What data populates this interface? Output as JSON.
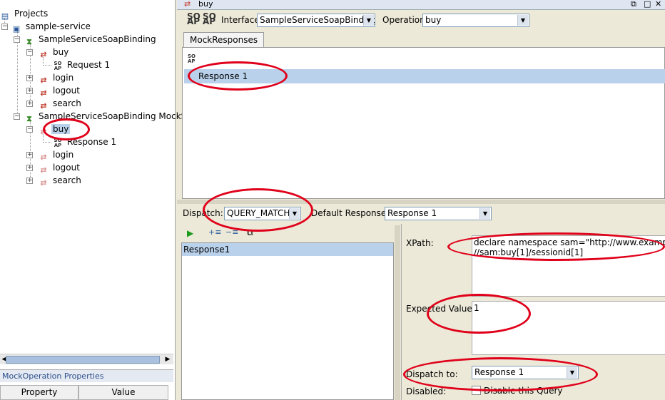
{
  "tree": {
    "projects": "Projects",
    "project": "sample-service",
    "binding": "SampleServiceSoapBinding",
    "binding_ops": [
      "buy",
      "login",
      "logout",
      "search"
    ],
    "request": "Request 1",
    "mock_service": "SampleServiceSoapBinding MockSe",
    "mock_ops": [
      "buy",
      "login",
      "logout",
      "search"
    ],
    "mock_response": "Response 1"
  },
  "props": {
    "title": "MockOperation Properties",
    "col_property": "Property",
    "col_value": "Value"
  },
  "window": {
    "title": "buy"
  },
  "toolbar": {
    "interface_label": "Interface",
    "interface_value": "SampleServiceSoapBinding",
    "operation_label": "Operation",
    "operation_value": "buy"
  },
  "mock_responses": {
    "tab_label": "MockResponses",
    "items": [
      "Response 1"
    ]
  },
  "dispatch": {
    "label": "Dispatch:",
    "value": "QUERY_MATCH",
    "default_response_label": "Default Response:",
    "default_response_value": "Response 1"
  },
  "queries": {
    "items": [
      "Response1"
    ]
  },
  "detail": {
    "xpath_label": "XPath:",
    "xpath_line1": "declare namespace sam=\"http://www.example.or",
    "xpath_line2": "//sam:buy[1]/sessionid[1]",
    "expected_label": "Expected Value:",
    "expected_value": "1",
    "dispatch_to_label": "Dispatch to:",
    "dispatch_to_value": "Response 1",
    "disabled_label": "Disabled:",
    "disable_query_label": "Disable this Query"
  },
  "colors": {
    "selection": "#b9d1ea",
    "annotation": "#e0001a"
  }
}
